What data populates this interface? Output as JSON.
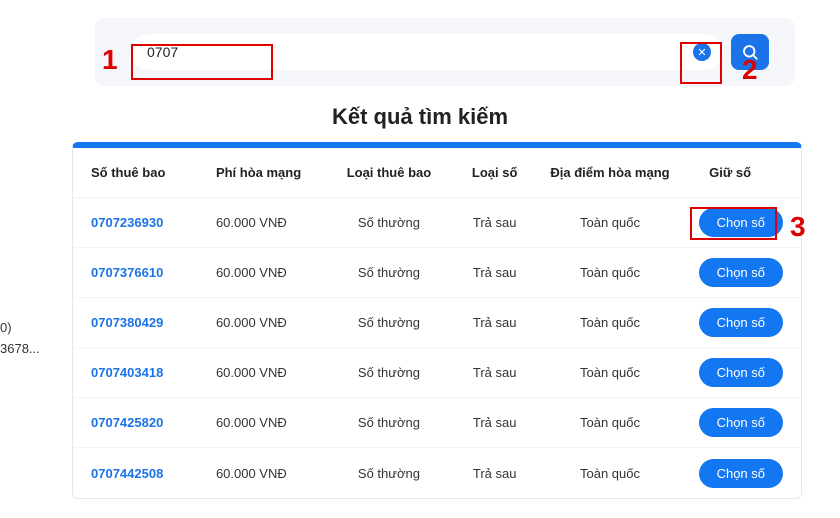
{
  "search": {
    "value": "0707"
  },
  "results_heading": "Kết quả tìm kiếm",
  "columns": {
    "phone": "Số thuê bao",
    "fee": "Phí hòa mạng",
    "type": "Loại thuê bao",
    "kind": "Loại số",
    "location": "Địa điểm hòa mạng",
    "hold": "Giữ số"
  },
  "choose_label": "Chọn số",
  "rows": [
    {
      "phone": "0707236930",
      "fee": "60.000 VNĐ",
      "type": "Số thường",
      "kind": "Trả sau",
      "location": "Toàn quốc"
    },
    {
      "phone": "0707376610",
      "fee": "60.000 VNĐ",
      "type": "Số thường",
      "kind": "Trả sau",
      "location": "Toàn quốc"
    },
    {
      "phone": "0707380429",
      "fee": "60.000 VNĐ",
      "type": "Số thường",
      "kind": "Trả sau",
      "location": "Toàn quốc"
    },
    {
      "phone": "0707403418",
      "fee": "60.000 VNĐ",
      "type": "Số thường",
      "kind": "Trả sau",
      "location": "Toàn quốc"
    },
    {
      "phone": "0707425820",
      "fee": "60.000 VNĐ",
      "type": "Số thường",
      "kind": "Trả sau",
      "location": "Toàn quốc"
    },
    {
      "phone": "0707442508",
      "fee": "60.000 VNĐ",
      "type": "Số thường",
      "kind": "Trả sau",
      "location": "Toàn quốc"
    }
  ],
  "annotations": {
    "n1": "1",
    "n2": "2",
    "n3": "3"
  },
  "edge_text": {
    "line1": "0)",
    "line2": "3678..."
  }
}
